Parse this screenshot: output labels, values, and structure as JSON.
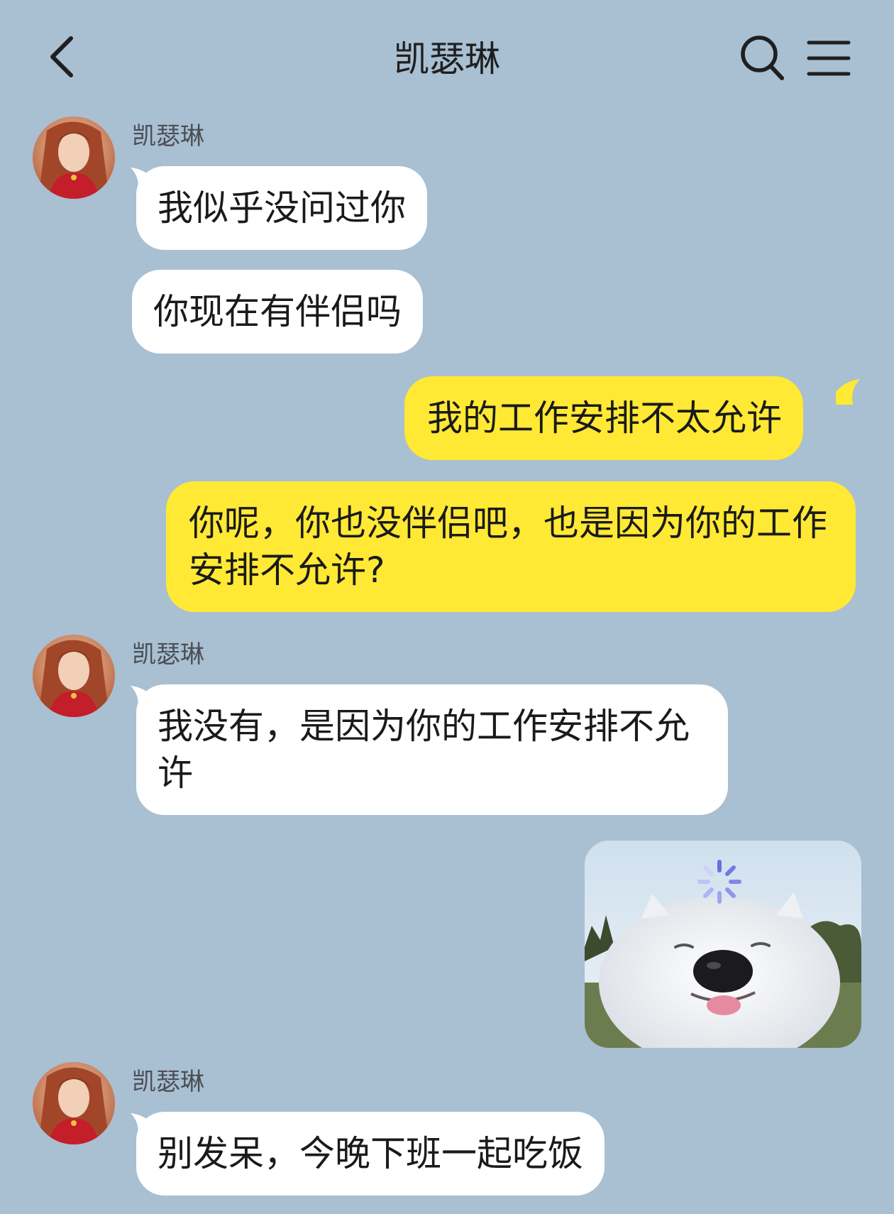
{
  "header": {
    "title": "凯瑟琳",
    "back_icon": "chevron-left-icon",
    "search_icon": "search-icon",
    "menu_icon": "menu-icon"
  },
  "messages": [
    {
      "side": "left",
      "sender": "凯瑟琳",
      "text": "我似乎没问过你"
    },
    {
      "side": "left",
      "text": "你现在有伴侣吗"
    },
    {
      "side": "right",
      "text": "我的工作安排不太允许"
    },
    {
      "side": "right",
      "text": "你呢，你也没伴侣吧，也是因为你的工作安排不允许?"
    },
    {
      "side": "left",
      "sender": "凯瑟琳",
      "text": "我没有，是因为你的工作安排不允许"
    },
    {
      "side": "right",
      "type": "image",
      "icon": "smiling-dog-loading-sticker"
    },
    {
      "side": "left",
      "sender": "凯瑟琳",
      "text": "别发呆，今晚下班一起吃饭"
    }
  ],
  "colors": {
    "background": "#a9bfd2",
    "incoming_bubble": "#ffffff",
    "outgoing_bubble": "#ffe935"
  }
}
